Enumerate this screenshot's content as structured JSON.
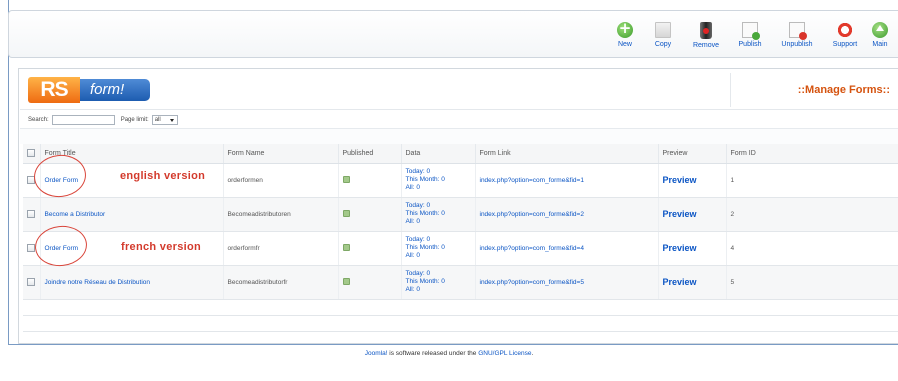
{
  "toolbar": {
    "buttons": [
      {
        "label": "New",
        "icon": "plus-circle-icon"
      },
      {
        "label": "Copy",
        "icon": "copy-icon"
      },
      {
        "label": "Remove",
        "icon": "trash-icon"
      },
      {
        "label": "Publish",
        "icon": "publish-icon"
      },
      {
        "label": "Unpublish",
        "icon": "unpublish-icon"
      },
      {
        "label": "Support",
        "icon": "lifebuoy-icon"
      },
      {
        "label": "Main",
        "icon": "up-arrow-icon"
      }
    ]
  },
  "header": {
    "logo_rs": "RS",
    "logo_form": "form!",
    "title": "::Manage Forms::"
  },
  "filters": {
    "search_label": "Search:",
    "page_limit_label": "Page limit:",
    "page_limit_value": "all"
  },
  "table": {
    "columns": [
      "Form Title",
      "Form Name",
      "Published",
      "Data",
      "Form Link",
      "Preview",
      "Form ID"
    ],
    "rows": [
      {
        "title": "Order Form",
        "name": "orderformen",
        "data": [
          "Today: 0",
          "This Month: 0",
          "All: 0"
        ],
        "link": "index.php?option=com_forme&fid=1",
        "preview": "Preview",
        "id": "1"
      },
      {
        "title": "Become a Distributor",
        "name": "Becomeadistributoren",
        "data": [
          "Today: 0",
          "This Month: 0",
          "All: 0"
        ],
        "link": "index.php?option=com_forme&fid=2",
        "preview": "Preview",
        "id": "2"
      },
      {
        "title": "Order Form",
        "name": "orderformfr",
        "data": [
          "Today: 0",
          "This Month: 0",
          "All: 0"
        ],
        "link": "index.php?option=com_forme&fid=4",
        "preview": "Preview",
        "id": "4"
      },
      {
        "title": "Joindre notre Réseau de Distribution",
        "name": "Becomeadistributorfr",
        "data": [
          "Today: 0",
          "This Month: 0",
          "All: 0"
        ],
        "link": "index.php?option=com_forme&fid=5",
        "preview": "Preview",
        "id": "5"
      }
    ]
  },
  "annotations": {
    "english": "english version",
    "french": "french version"
  },
  "footer": {
    "joomla": "Joomla!",
    "text": " is software released under the ",
    "license": "GNU/GPL License",
    "end": "."
  },
  "colors": {
    "link": "#0b55c4",
    "accent": "#d5530f",
    "annotation": "#d33a2c"
  }
}
